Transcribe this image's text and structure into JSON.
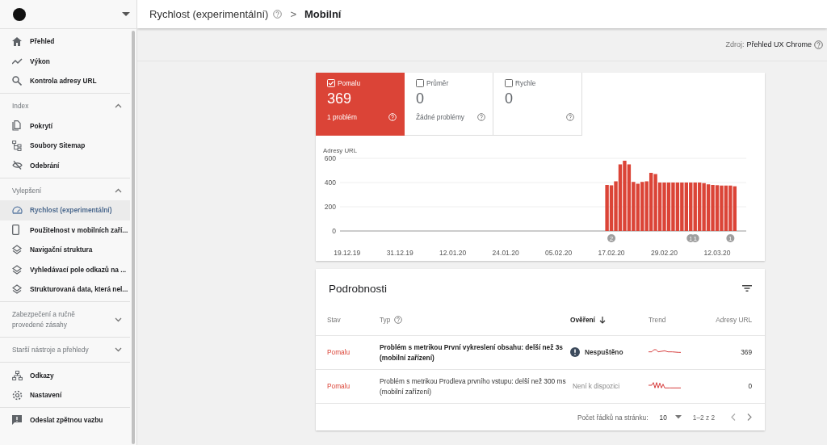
{
  "sidebar": {
    "items": [
      {
        "label": "Přehled",
        "selected": false
      },
      {
        "label": "Výkon",
        "selected": false
      },
      {
        "label": "Kontrola adresy URL",
        "selected": false
      }
    ],
    "sections": [
      {
        "title": "Index",
        "expanded": true,
        "items": [
          {
            "label": "Pokrytí",
            "selected": false
          },
          {
            "label": "Soubory Sitemap",
            "selected": false
          },
          {
            "label": "Odebrání",
            "selected": false
          }
        ]
      },
      {
        "title": "Vylepšení",
        "expanded": true,
        "items": [
          {
            "label": "Rychlost (experimentální)",
            "selected": true
          },
          {
            "label": "Použitelnost v mobilních zaří...",
            "selected": false
          },
          {
            "label": "Navigační struktura",
            "selected": false
          },
          {
            "label": "Vyhledávací pole odkazů na ...",
            "selected": false
          },
          {
            "label": "Strukturovaná data, která nel...",
            "selected": false
          }
        ]
      },
      {
        "title": "Zabezpečení a ručně provedené zásahy",
        "expanded": false
      },
      {
        "title": "Starší nástroje a přehledy",
        "expanded": false
      }
    ],
    "bottom_items": [
      {
        "label": "Odkazy",
        "selected": false
      },
      {
        "label": "Nastavení",
        "selected": false
      }
    ],
    "feedback": {
      "label": "Odeslat zpětnou vazbu"
    }
  },
  "breadcrumb": {
    "parent": "Rychlost (experimentální)",
    "separator": ">",
    "current": "Mobilní"
  },
  "source": {
    "label": "Zdroj:",
    "value": "Přehled UX Chrome"
  },
  "status_tiles": [
    {
      "label": "Pomalu",
      "count": "369",
      "subtitle": "1 problém",
      "checked": true,
      "selected": true
    },
    {
      "label": "Průměr",
      "count": "0",
      "subtitle": "Žádné problémy",
      "checked": false,
      "selected": false
    },
    {
      "label": "Rychle",
      "count": "0",
      "checked": false,
      "selected": false
    }
  ],
  "chart": {
    "chart_data": {
      "type": "bar",
      "ylabel": "Adresy URL",
      "categories": [
        "19.12.19",
        null,
        null,
        null,
        null,
        null,
        null,
        null,
        null,
        null,
        null,
        null,
        "31.12.19",
        null,
        null,
        null,
        null,
        null,
        null,
        null,
        null,
        null,
        null,
        null,
        "12.01.20",
        null,
        null,
        null,
        null,
        null,
        null,
        null,
        null,
        null,
        null,
        null,
        "24.01.20",
        null,
        null,
        null,
        null,
        null,
        null,
        null,
        null,
        null,
        null,
        null,
        "05.02.20",
        null,
        null,
        null,
        null,
        null,
        null,
        null,
        null,
        null,
        null,
        null,
        "17.02.20",
        null,
        null,
        null,
        null,
        null,
        null,
        null,
        null,
        null,
        null,
        null,
        "29.02.20",
        null,
        null,
        null,
        null,
        null,
        null,
        null,
        null,
        null,
        null,
        null,
        "12.03.20",
        null,
        null,
        null,
        null
      ],
      "series": [
        {
          "color": "#db4437",
          "values": [
            null,
            null,
            null,
            null,
            null,
            null,
            null,
            null,
            null,
            null,
            null,
            null,
            null,
            null,
            null,
            null,
            null,
            null,
            null,
            null,
            null,
            null,
            null,
            null,
            null,
            null,
            null,
            null,
            null,
            null,
            null,
            null,
            null,
            null,
            null,
            null,
            null,
            null,
            null,
            null,
            null,
            null,
            null,
            null,
            null,
            null,
            null,
            null,
            null,
            null,
            null,
            null,
            null,
            null,
            null,
            null,
            null,
            null,
            null,
            380,
            377,
            410,
            550,
            580,
            550,
            405,
            390,
            405,
            410,
            480,
            470,
            400,
            400,
            400,
            400,
            400,
            400,
            400,
            400,
            400,
            400,
            395,
            385,
            380,
            378,
            375,
            375,
            375,
            369
          ]
        }
      ],
      "ylim": [
        0,
        600
      ],
      "yticks": [
        0,
        200,
        400,
        600
      ],
      "annotations": [
        "2",
        "1",
        "1",
        "1"
      ]
    }
  },
  "details": {
    "title": "Podrobnosti",
    "columns": [
      {
        "label": "Stav",
        "sorted": false,
        "help": false
      },
      {
        "label": "Typ",
        "sorted": false,
        "help": true
      },
      {
        "label": "Ověření",
        "sorted": true,
        "help": false
      },
      {
        "label": "Trend",
        "sorted": false,
        "help": false
      },
      {
        "label": "Adresy URL",
        "sorted": false,
        "help": false
      }
    ],
    "rows": [
      {
        "status": "Pomalu",
        "type": "Problém s metrikou První vykreslení obsahu: delší než 3s (mobilní zařízení)",
        "bold": true,
        "validation": {
          "kind": "alert",
          "label": "Nespuštěno"
        },
        "urls": "369"
      },
      {
        "status": "Pomalu",
        "type": "Problém s metrikou Prodleva prvního vstupu: delší než 300 ms (mobilní zařízení)",
        "bold": false,
        "validation": {
          "kind": "none",
          "label": "Není k dispozici"
        },
        "urls": "0"
      }
    ],
    "pagination": {
      "rows_label": "Počet řádků na stránku:",
      "rows_value": "10",
      "range": "1–2 z 2"
    }
  }
}
